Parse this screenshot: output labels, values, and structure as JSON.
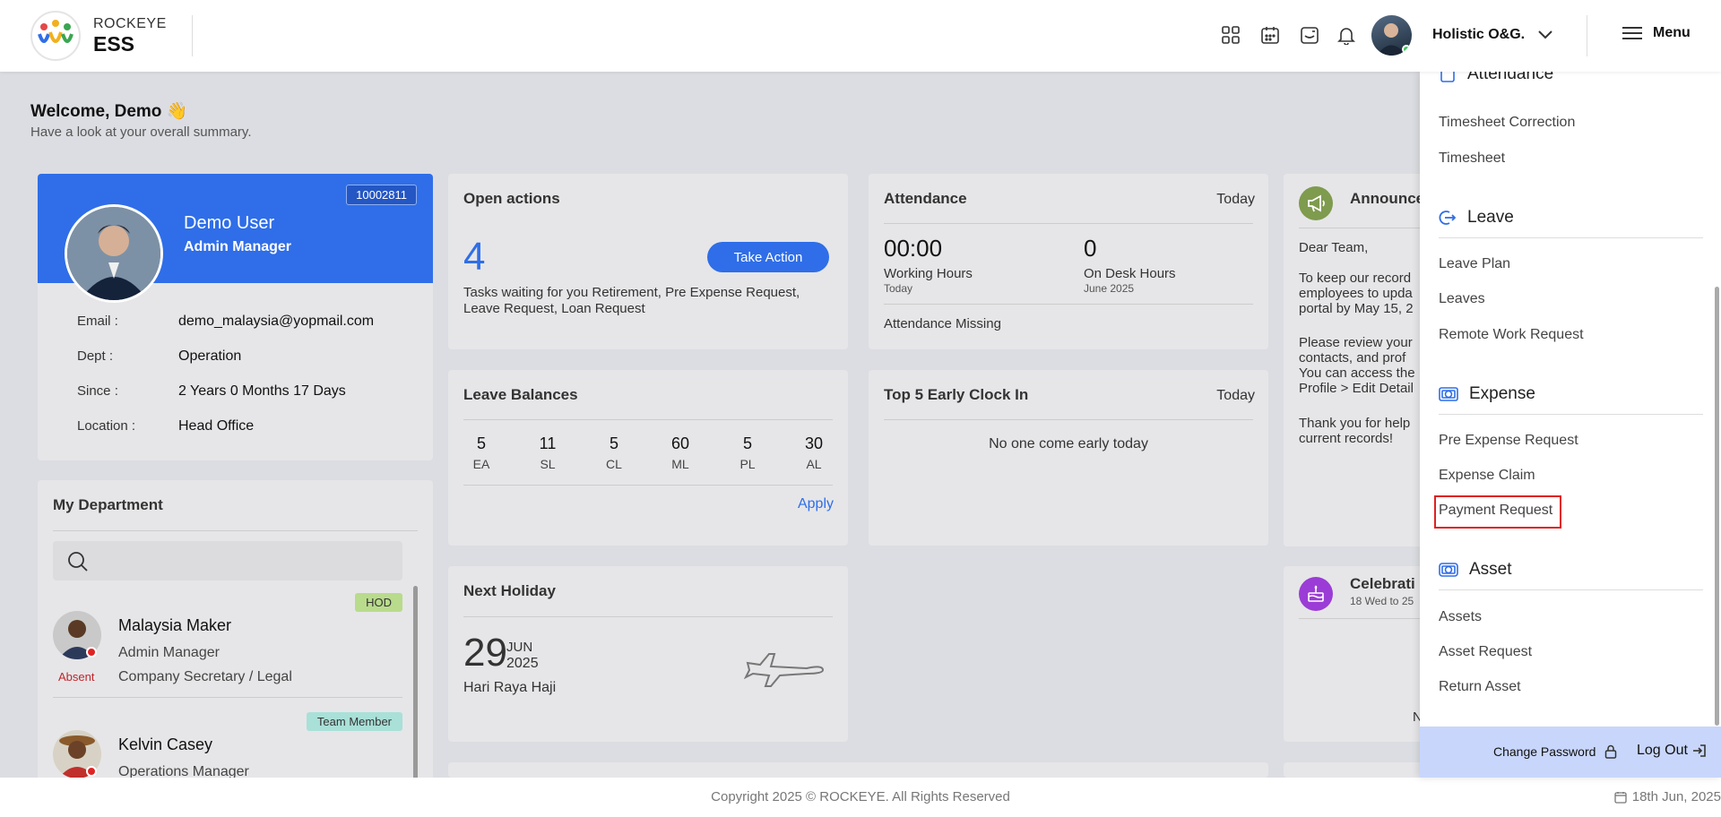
{
  "header": {
    "brand_small": "ROCKEYE",
    "brand_large": "ESS",
    "company": "Holistic O&G.",
    "menu_label": "Menu"
  },
  "welcome": {
    "title": "Welcome, Demo 👋",
    "subtitle": "Have a look at your overall summary."
  },
  "profile": {
    "emp_id": "10002811",
    "name": "Demo User",
    "role": "Admin Manager",
    "fields": [
      {
        "label": "Email :",
        "value": "demo_malaysia@yopmail.com"
      },
      {
        "label": "Dept :",
        "value": "Operation"
      },
      {
        "label": "Since :",
        "value": "2 Years 0 Months 17 Days"
      },
      {
        "label": "Location :",
        "value": "Head Office"
      }
    ]
  },
  "department": {
    "title": "My Department",
    "members": [
      {
        "name": "Malaysia Maker",
        "role": "Admin Manager",
        "dept": "Company Secretary / Legal",
        "badge": "HOD",
        "status": "Absent"
      },
      {
        "name": "Kelvin Casey",
        "role": "Operations Manager",
        "badge": "Team Member"
      }
    ]
  },
  "open_actions": {
    "title": "Open actions",
    "count": "4",
    "button": "Take Action",
    "description": "Tasks waiting for you Retirement, Pre Expense Request, Leave Request, Loan Request"
  },
  "leave_balances": {
    "title": "Leave Balances",
    "items": [
      {
        "value": "5",
        "code": "EA"
      },
      {
        "value": "11",
        "code": "SL"
      },
      {
        "value": "5",
        "code": "CL"
      },
      {
        "value": "60",
        "code": "ML"
      },
      {
        "value": "5",
        "code": "PL"
      },
      {
        "value": "30",
        "code": "AL"
      }
    ],
    "apply": "Apply"
  },
  "next_holiday": {
    "title": "Next Holiday",
    "day": "29",
    "month": "JUN",
    "year": "2025",
    "name": "Hari Raya Haji"
  },
  "attendance": {
    "title": "Attendance",
    "period": "Today",
    "working_hours": "00:00",
    "working_label": "Working Hours",
    "working_sub": "Today",
    "desk_hours": "0",
    "desk_label": "On Desk Hours",
    "desk_sub": "June 2025",
    "missing": "Attendance Missing"
  },
  "early_clock": {
    "title": "Top 5 Early Clock In",
    "period": "Today",
    "message": "No one come early today"
  },
  "announcement": {
    "title": "Announce",
    "lines": [
      "Dear Team,",
      "To keep our record",
      "employees to upda",
      "portal by May 15, 2",
      "Please review your",
      "contacts, and prof",
      "You can access the",
      "Profile > Edit Detail",
      "Thank you for help",
      "current records!"
    ]
  },
  "celebration": {
    "title": "Celebrati",
    "subtitle": "18 Wed to 25",
    "partial": "N"
  },
  "side_menu": {
    "attendance_section": "Attendance",
    "attendance_items": [
      "Timesheet Correction",
      "Timesheet"
    ],
    "leave_section": "Leave",
    "leave_items": [
      "Leave Plan",
      "Leaves",
      "Remote Work Request"
    ],
    "expense_section": "Expense",
    "expense_items": [
      "Pre Expense Request",
      "Expense Claim",
      "Payment Request"
    ],
    "asset_section": "Asset",
    "asset_items": [
      "Assets",
      "Asset Request",
      "Return Asset"
    ],
    "change_password": "Change Password",
    "log_out": "Log Out"
  },
  "footer": {
    "copyright": "Copyright 2025 © ROCKEYE. All Rights Reserved",
    "date": "18th Jun, 2025"
  },
  "colors": {
    "accent": "#2f6ee8",
    "hod_badge": "#b9db8c",
    "team_badge": "#a9e0d8",
    "absent": "#c0262c",
    "highlight": "#e02020"
  }
}
